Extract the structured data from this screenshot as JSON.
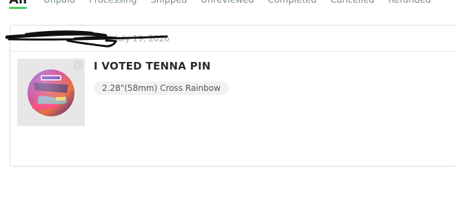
{
  "tabs": [
    {
      "label": "All",
      "active": true
    },
    {
      "label": "Unpaid"
    },
    {
      "label": "Processing"
    },
    {
      "label": "Shipped"
    },
    {
      "label": "Unreviewed"
    },
    {
      "label": "Completed"
    },
    {
      "label": "Cancelled"
    },
    {
      "label": "Refunded"
    }
  ],
  "order": {
    "date": "July 19, 2026",
    "item": {
      "title": "I VOTED TENNA PIN",
      "variant": "2.28\"(58mm) Cross Rainbow",
      "thumbnail_icon": "rainbow-button-pin-icon"
    }
  },
  "colors": {
    "active_tab_underline": "#3fcf5e",
    "inactive_tab_text": "#7b8a94",
    "card_border": "#dcdcdc"
  }
}
